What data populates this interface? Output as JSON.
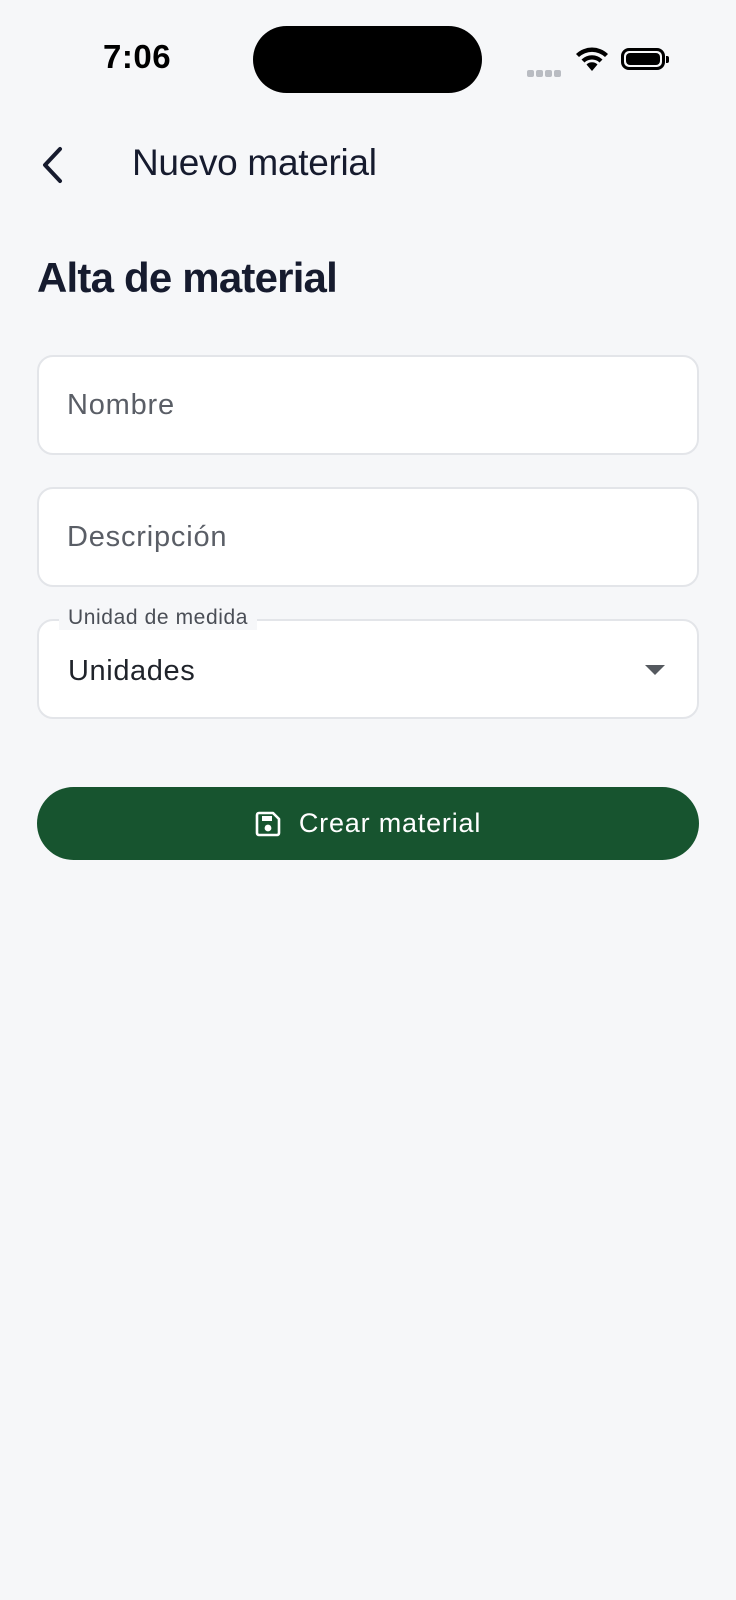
{
  "status_bar": {
    "time": "7:06"
  },
  "app_bar": {
    "back_icon": "chevron-left-icon",
    "title": "Nuevo material"
  },
  "page": {
    "heading": "Alta de material"
  },
  "form": {
    "nombre": {
      "value": "",
      "placeholder": "Nombre"
    },
    "descripcion": {
      "value": "",
      "placeholder": "Descripción"
    },
    "unidad": {
      "label": "Unidad de medida",
      "selected": "Unidades",
      "icon": "dropdown-arrow-icon"
    },
    "submit": {
      "label": "Crear material",
      "icon": "save-icon",
      "color": "#17542f"
    }
  },
  "colors": {
    "background": "#f6f7f9",
    "accent": "#17542f",
    "text": "#161b2e"
  }
}
